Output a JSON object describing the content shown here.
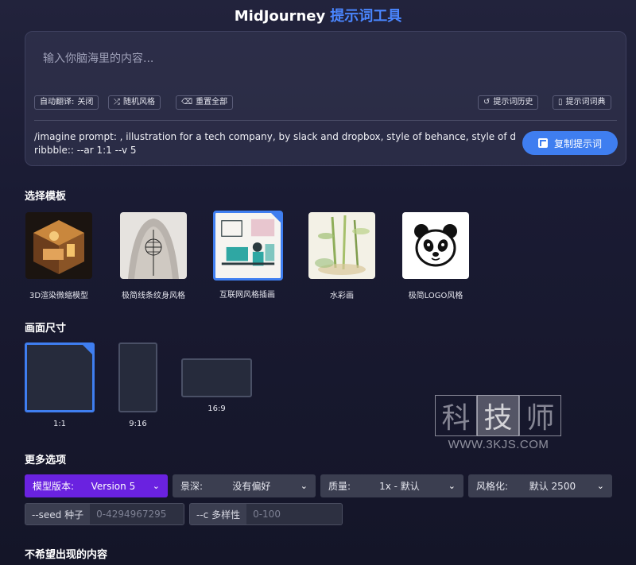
{
  "header": {
    "title_brand": "MidJourney",
    "title_tool": "提示词工具"
  },
  "prompt": {
    "placeholder": "输入你脑海里的内容...",
    "auto_translate_label": "自动翻译:",
    "auto_translate_value": "关闭",
    "random_style_label": "随机风格",
    "reset_label": "重置全部",
    "history_label": "提示词历史",
    "dictionary_label": "提示词词典",
    "generated_text": "/imagine prompt: , illustration for a tech company, by slack and dropbox, style of behance, style of dribbble:: --ar 1:1 --v 5",
    "copy_label": "复制提示词"
  },
  "templates": {
    "title": "选择模板",
    "items": [
      {
        "label": "3D渲染微缩模型"
      },
      {
        "label": "极简线条纹身风格"
      },
      {
        "label": "互联网风格插画",
        "selected": true
      },
      {
        "label": "水彩画"
      },
      {
        "label": "极简LOGO风格"
      }
    ]
  },
  "sizes": {
    "title": "画面尺寸",
    "items": [
      {
        "label": "1:1",
        "selected": true
      },
      {
        "label": "9:16"
      },
      {
        "label": "16:9"
      }
    ]
  },
  "more": {
    "title": "更多选项",
    "model_label": "模型版本:",
    "model_value": "Version 5",
    "depth_label": "景深:",
    "depth_value": "没有偏好",
    "quality_label": "质量:",
    "quality_value": "1x - 默认",
    "stylize_label": "风格化:",
    "stylize_value": "默认 2500",
    "seed_label": "--seed 种子",
    "seed_placeholder": "0-4294967295",
    "chaos_label": "--c 多样性",
    "chaos_placeholder": "0-100"
  },
  "negative": {
    "title": "不希望出现的内容"
  },
  "watermark": {
    "chars": [
      "科",
      "技",
      "师"
    ],
    "url": "WWW.3KJS.COM"
  },
  "colors": {
    "accent": "#3f7ef0",
    "active_dropdown": "#6a22e0",
    "background": "#1a1b33"
  }
}
